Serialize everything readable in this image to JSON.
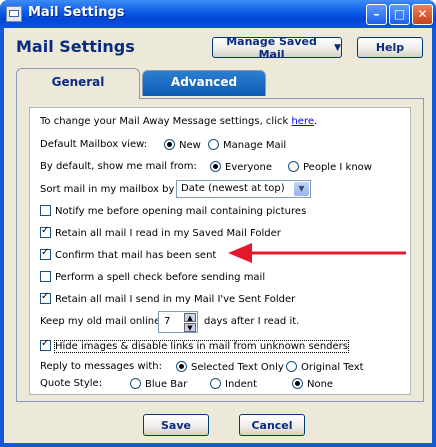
{
  "window": {
    "title": "Mail Settings",
    "buttons": {
      "minimize": "–",
      "maximize": "□",
      "close": "✕"
    }
  },
  "header": {
    "title": "Mail Settings",
    "manage_saved_label": "Manage Saved Mail",
    "help_label": "Help"
  },
  "tabs": [
    {
      "label": "General",
      "active": true
    },
    {
      "label": "Advanced",
      "active": false
    }
  ],
  "general": {
    "intro_text": "To change your Mail Away Message settings, click",
    "intro_link": "here",
    "intro_end": ".",
    "default_view": {
      "label": "Default Mailbox view:",
      "options": [
        "New",
        "Manage Mail"
      ],
      "selected": "New"
    },
    "show_from": {
      "label": "By default, show me mail from:",
      "options": [
        "Everyone",
        "People I know"
      ],
      "selected": "Everyone"
    },
    "sort": {
      "label": "Sort mail in my mailbox by",
      "value": "Date (newest at top)"
    },
    "checkboxes": [
      {
        "label": "Notify me before opening mail containing pictures",
        "checked": false
      },
      {
        "label": "Retain all mail I read in my Saved Mail Folder",
        "checked": true
      },
      {
        "label": "Confirm that mail has been sent",
        "checked": true
      },
      {
        "label": "Perform a spell check before sending mail",
        "checked": false
      },
      {
        "label": "Retain all mail I send in my Mail I've Sent Folder",
        "checked": true
      }
    ],
    "keep_old": {
      "prefix": "Keep my old mail online",
      "value": "7",
      "suffix": "days after I read it."
    },
    "hide_images": {
      "label": "Hide images & disable links in mail from unknown senders",
      "checked": true
    },
    "reply_with": {
      "label": "Reply to messages with:",
      "options": [
        "Selected Text Only",
        "Original Text"
      ],
      "selected": "Selected Text Only"
    },
    "quote_style": {
      "label": "Quote Style:",
      "options": [
        "Blue Bar",
        "Indent",
        "None"
      ],
      "selected": "None"
    }
  },
  "footer": {
    "save_label": "Save",
    "cancel_label": "Cancel"
  },
  "colors": {
    "annotation_arrow": "#e0192b",
    "title_bar": "#0a5ae6"
  }
}
